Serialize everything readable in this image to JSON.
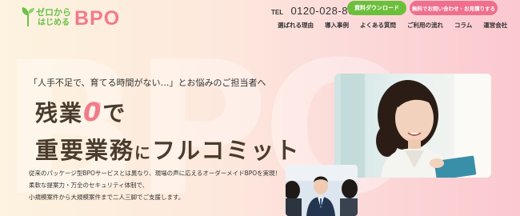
{
  "header": {
    "logo_small_top": "ゼロから",
    "logo_small_bottom": "はじめる",
    "logo_big": "BPO",
    "tel_label": "TEL",
    "tel_number": "0120-028-863",
    "download_button": "資料ダウンロード",
    "contact_button": "無料でお問い合わせ・お見積りする"
  },
  "nav": {
    "items": [
      "選ばれる理由",
      "導入事例",
      "よくある質問",
      "ご利用の流れ",
      "コラム",
      "運営会社"
    ]
  },
  "hero": {
    "background_text": "BPO",
    "tagline": "「人手不足で、育てる時間がない…」とお悩みのご担当者へ",
    "headline1_before": "残業",
    "headline1_zero": "0",
    "headline1_zero_ruby": "ゼロ",
    "headline1_after": "で",
    "headline2_part1": "重要業務",
    "headline2_part2": "に",
    "headline2_part3": "フルコミット",
    "desc_lines": [
      "従来のパッケージ型BPOサービスとは異なり、現場の声に応えるオーダーメイドBPOを実現！",
      "柔軟な提案力・万全のセキュリティ体制で、",
      "小規模案件から大規模案件まで二人三脚でご支援します。"
    ]
  },
  "colors": {
    "green": "#6cbf3b",
    "pink": "#ef6f8d",
    "brown": "#4a3c2c"
  }
}
